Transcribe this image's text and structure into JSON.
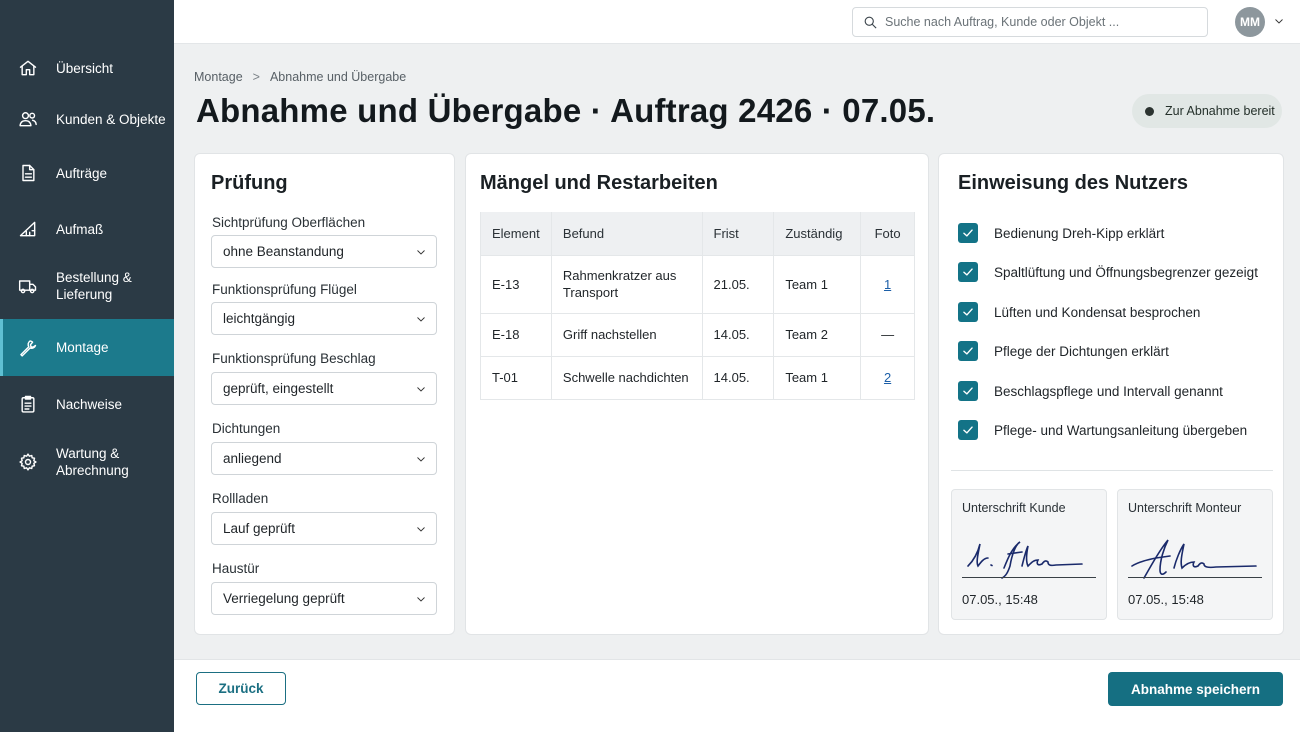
{
  "sidebar": {
    "items": [
      {
        "label": "Übersicht",
        "icon": "home-icon"
      },
      {
        "label": "Kunden & Objekte",
        "icon": "users-icon"
      },
      {
        "label": "Aufträge",
        "icon": "document-icon"
      },
      {
        "label": "Aufmaß",
        "icon": "ruler-triangle-icon"
      },
      {
        "label": "Bestellung & Lieferung",
        "icon": "truck-icon"
      },
      {
        "label": "Montage",
        "icon": "wrench-icon",
        "active": true
      },
      {
        "label": "Nachweise",
        "icon": "clipboard-icon"
      },
      {
        "label": "Wartung & Abrechnung",
        "icon": "gear-icon"
      }
    ]
  },
  "topbar": {
    "search_placeholder": "Suche nach Auftrag, Kunde oder Objekt ...",
    "avatar_initials": "MM"
  },
  "breadcrumb": {
    "parent": "Montage",
    "separator": ">",
    "current": "Abnahme und Übergabe"
  },
  "page": {
    "title": "Abnahme und Übergabe · Auftrag 2426 · 07.05.",
    "status": "Zur Abnahme bereit"
  },
  "pruefung": {
    "title": "Prüfung",
    "fields": [
      {
        "label": "Sichtprüfung Oberflächen",
        "value": "ohne Beanstandung"
      },
      {
        "label": "Funktionsprüfung Flügel",
        "value": "leichtgängig"
      },
      {
        "label": "Funktionsprüfung Beschlag",
        "value": "geprüft, eingestellt"
      },
      {
        "label": "Dichtungen",
        "value": "anliegend"
      },
      {
        "label": "Rollladen",
        "value": "Lauf geprüft"
      },
      {
        "label": "Haustür",
        "value": "Verriegelung geprüft"
      }
    ]
  },
  "maengel": {
    "title": "Mängel und Restarbeiten",
    "columns": [
      "Element",
      "Befund",
      "Frist",
      "Zuständig",
      "Foto"
    ],
    "rows": [
      {
        "element": "E-13",
        "befund": "Rahmenkratzer aus Transport",
        "frist": "21.05.",
        "zustaendig": "Team 1",
        "foto": "1"
      },
      {
        "element": "E-18",
        "befund": "Griff nachstellen",
        "frist": "14.05.",
        "zustaendig": "Team 2",
        "foto": "—"
      },
      {
        "element": "T-01",
        "befund": "Schwelle nachdichten",
        "frist": "14.05.",
        "zustaendig": "Team 1",
        "foto": "2"
      }
    ]
  },
  "einweisung": {
    "title": "Einweisung des Nutzers",
    "items": [
      {
        "label": "Bedienung Dreh-Kipp erklärt",
        "checked": true
      },
      {
        "label": "Spaltlüftung und Öffnungsbegrenzer gezeigt",
        "checked": true
      },
      {
        "label": "Lüften und Kondensat besprochen",
        "checked": true
      },
      {
        "label": "Pflege der Dichtungen erklärt",
        "checked": true
      },
      {
        "label": "Beschlagspflege und Intervall genannt",
        "checked": true
      },
      {
        "label": "Pflege- und Wartungsanleitung übergeben",
        "checked": true
      }
    ],
    "signatures": [
      {
        "label": "Unterschrift Kunde",
        "timestamp": "07.05., 15:48"
      },
      {
        "label": "Unterschrift Monteur",
        "timestamp": "07.05., 15:48"
      }
    ]
  },
  "footer": {
    "back_label": "Zurück",
    "save_label": "Abnahme speichern"
  },
  "colors": {
    "sidebar_bg": "#2b3a45",
    "active_item": "#1c7a8c",
    "primary": "#156f82",
    "checkbox": "#137387"
  }
}
